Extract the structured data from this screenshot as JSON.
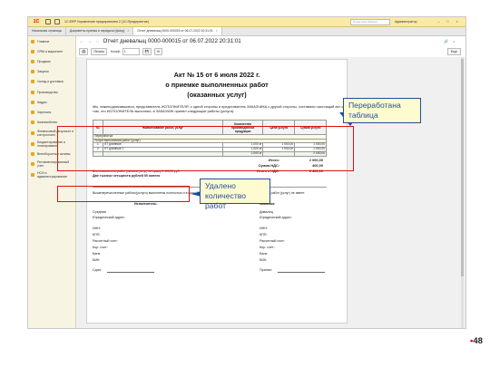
{
  "app": {
    "logo": "1С",
    "title": "1С:ERP Управление предприятием 2  (1С:Предприятие)",
    "search_placeholder": "Поиск (Ctrl+Shift+F)",
    "user": "Администратор"
  },
  "tabs": [
    {
      "label": "Начальная страница"
    },
    {
      "label": "Документы приема и передачи (фонд)"
    },
    {
      "label": "Отчет дневальщ 0000-000015 от 06.07.2022 20:31:01"
    }
  ],
  "sidebar": {
    "items": [
      {
        "label": "Главное"
      },
      {
        "label": "CRM и маркетинг"
      },
      {
        "label": "Продажи"
      },
      {
        "label": "Закупки"
      },
      {
        "label": "Склад и доставка"
      },
      {
        "label": "Производство"
      },
      {
        "label": "Кадры"
      },
      {
        "label": "Зарплата"
      },
      {
        "label": "Казначейство"
      },
      {
        "label": "Финансовый результат и контроллинг"
      },
      {
        "label": "Бюджетирование и планирование"
      },
      {
        "label": "Внеоборотные активы"
      },
      {
        "label": "Регламентированный учет"
      },
      {
        "label": "НСИ и администрирование"
      }
    ]
  },
  "document": {
    "header_title": "Отчет дневальщ 0000-000015 от 06.07.2022 20:31:01",
    "toolbar": {
      "print_label": "Печать",
      "copies_label": "Копий:",
      "copies_value": "1",
      "more_label": "Еще"
    }
  },
  "act": {
    "title_line1": "Акт № 15 от 6 июля 2022 г.",
    "title_line2": "о приемке выполненных работ",
    "title_line3": "(оказанных услуг)",
    "intro": "Мы, нижеподписавшиеся, представитель ИСПОЛНИТЕЛЯ, с одной стороны и представитель ЗАКАЗЧИКА с другой стороны, составили настоящий акт о том, что ИСПОЛНИТЕЛЬ выполнил, а ЗАКАЗЧИК принял следующие работы (услуги):",
    "table": {
      "headers": [
        "№",
        "Наименование работ, услуг",
        "Количество произведенной продукции",
        "Цена услуги",
        "Сумма услуги"
      ],
      "group_rows": [
        "Переработка",
        "Услуги выполнения работ (услуг)"
      ],
      "rows": [
        {
          "num": "1",
          "name": "ЛТ длинные",
          "qty": "1,000 кг",
          "price": "1 000,00",
          "sum": "1 000,00"
        },
        {
          "num": "2",
          "name": "ЛТ длинные 2",
          "qty": "1,000 кг",
          "price": "1 000,00",
          "sum": "1 000,00"
        }
      ],
      "total_row": {
        "qty": "2,000 кг",
        "sum": "2 000,00"
      }
    },
    "totals": [
      {
        "label": "Итого:",
        "value": "2 000,00"
      },
      {
        "label": "Сумма НДС:",
        "value": "400,00"
      },
      {
        "label": "Итого с НДС:",
        "value": "2 400,00"
      }
    ],
    "sum_text_line1": "Всего выполнено работ (оказано услуг) на сумму 2 400,00 руб.",
    "sum_text_line2": "Две тысячи четыреста рублей 00 копеек",
    "closing": "Вышеперечисленные работы(услуги) выполнены полностью и в срок. Заказчик претензий по объему, качеству и срокам работ (услуг) не имеет.",
    "executor": {
      "heading": "Исполнитель:",
      "name": "Средняя",
      "legal_address": "Юридический адрес:",
      "inn": "ИНН:",
      "kpp": "КПП:",
      "account": "Расчетный счет:",
      "corr": "Кор. счет:",
      "bank": "Банк:",
      "bik": "БИК:",
      "sign": "Сдал:"
    },
    "customer": {
      "heading": "Заказчик:",
      "name": "Дивалиц",
      "legal_address": "Юридический адрес:",
      "inn": "ИНН:",
      "kpp": "КПП:",
      "account": "Расчетный счет:",
      "corr": "Кор. счет:",
      "bank": "Банк:",
      "bik": "БИК:",
      "sign": "Принял:"
    }
  },
  "callouts": {
    "reworked": "Переработана таблица",
    "removed": "Удалено количество работ"
  },
  "slide_number": "48",
  "colors": {
    "annotation_red": "#e01010",
    "callout_border": "#1f4e9e",
    "callout_fill": "#fffbd0",
    "titlebar": "#fbe9a6"
  }
}
